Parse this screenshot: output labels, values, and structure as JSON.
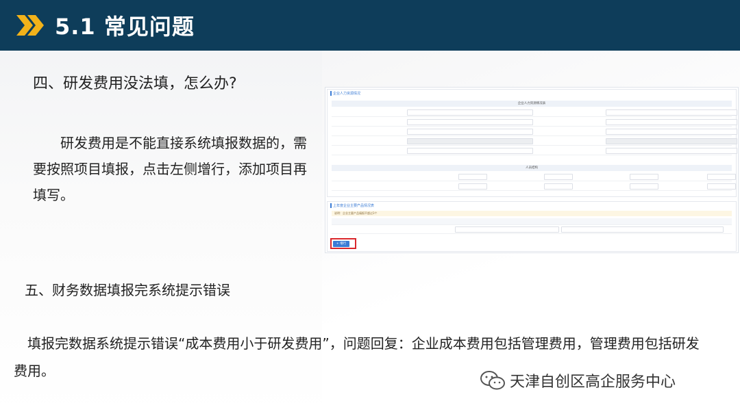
{
  "header": {
    "title": "5.1 常见问题",
    "colors": {
      "background": "#0e3d5a",
      "accent": "#f2b21a"
    }
  },
  "q1": {
    "heading": "四、研发费用没法填，怎么办?",
    "body": "　　研发费用是不能直接系统填报数据的，需要按照项目填报，点击左侧增行，添加项目再填写。"
  },
  "q2": {
    "heading": "五、财务数据填报完系统提示错误",
    "body": "　填报完数据系统提示错误“成本费用小于研发费用”，问题回复：企业成本费用包括管理费用，管理费用包括研发费用。"
  },
  "watermark": {
    "text": "天津自创区高企服务中心",
    "icon": "wechat-icon"
  },
  "screenshot": {
    "section1_title": "企业人力资源情况",
    "band1": "企业人力资源情况表",
    "band2": "人员结构",
    "section2_title": "上年度企业主要产品情况表",
    "note": "说明：企业主要产品填报不超过3个",
    "add_button": "+ 增行"
  }
}
